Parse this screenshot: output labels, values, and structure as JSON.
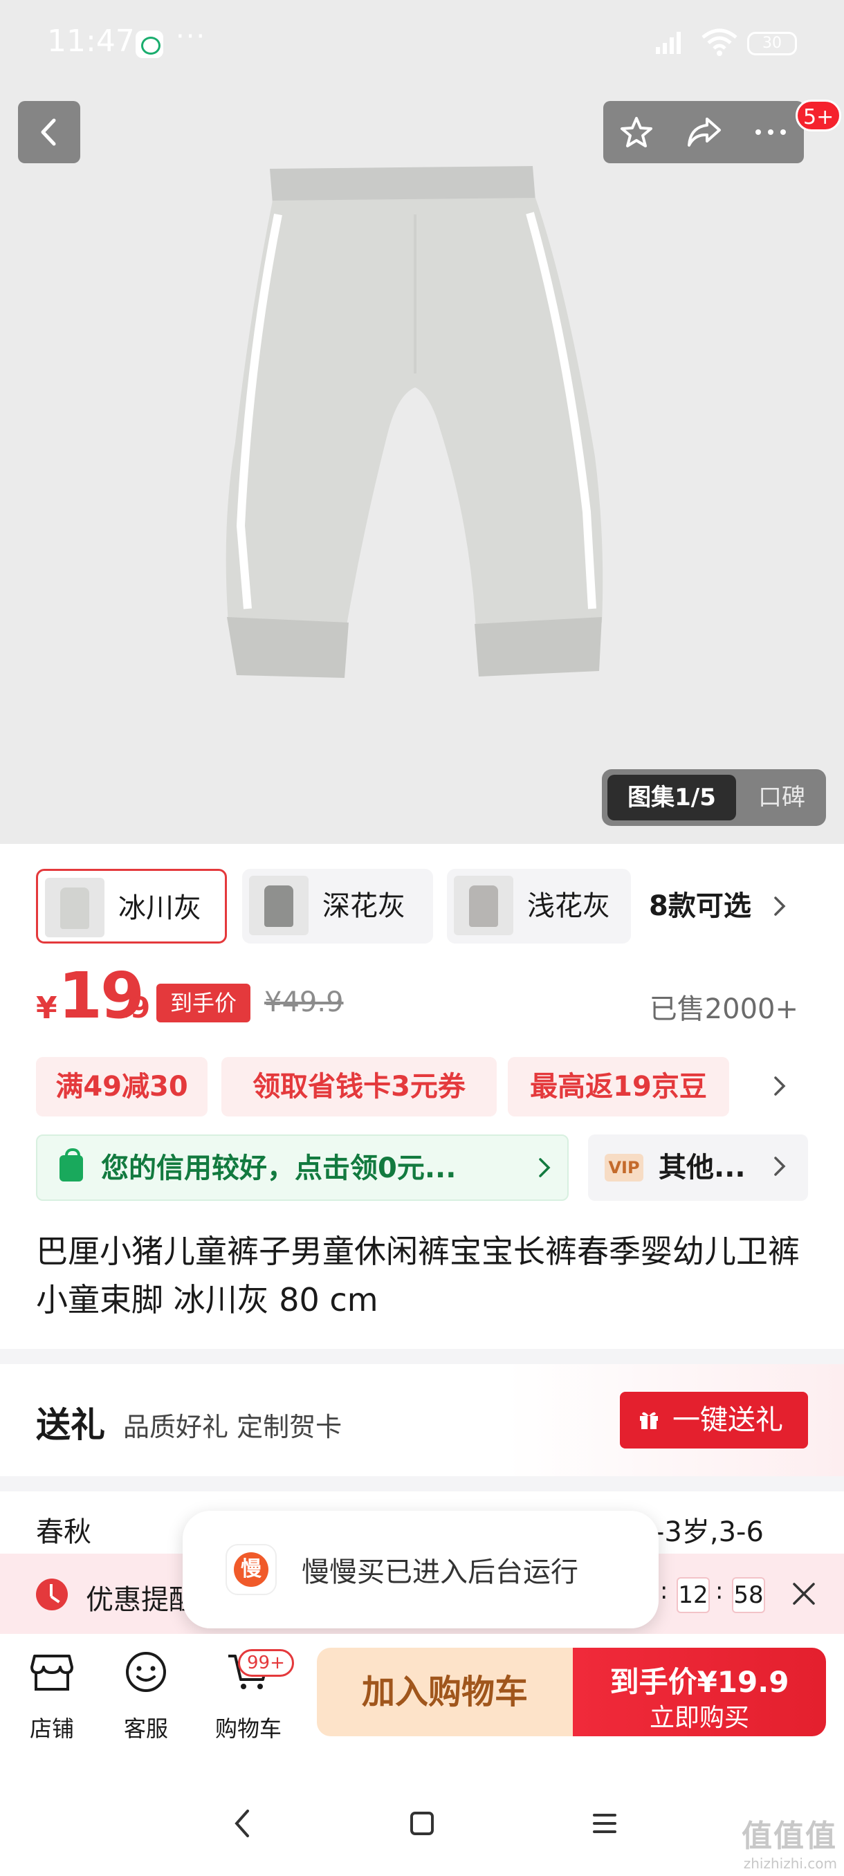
{
  "status_bar": {
    "time": "11:47",
    "dots": "···",
    "network": "HD",
    "battery": "30"
  },
  "hero": {
    "more_badge": "5+",
    "gallery_label": "图集1/5",
    "review_label": "口碑"
  },
  "variants": {
    "items": [
      {
        "label": "冰川灰",
        "selected": true
      },
      {
        "label": "深花灰",
        "selected": false
      },
      {
        "label": "浅花灰",
        "selected": false
      }
    ],
    "more_label": "8款可选"
  },
  "price": {
    "currency": "¥",
    "integer": "19",
    "decimal": ".9",
    "tag": "到手价",
    "original": "¥49.9",
    "sold": "已售2000+"
  },
  "promos": [
    "满49减30",
    "领取省钱卡3元券",
    "最高返19京豆"
  ],
  "credit": {
    "text": "您的信用较好，点击领0元...",
    "vip_badge": "VIP",
    "vip_text": "其他..."
  },
  "product": {
    "title": "巴厘小猪儿童裤子男童休闲裤宝宝长裤春季婴幼儿卫裤小童束脚 冰川灰 80 cm"
  },
  "gift": {
    "label": "送礼",
    "sub": "品质好礼 定制贺卡",
    "button": "一键送礼"
  },
  "spec": {
    "left": "春秋",
    "right": "-3岁,3-6"
  },
  "reminder": {
    "text": "优惠提醒",
    "timer_min": "12",
    "timer_sec": "58",
    "sep": ":"
  },
  "toast": {
    "icon_char": "慢",
    "text": "慢慢买已进入后台运行"
  },
  "bottom_bar": {
    "store": "店铺",
    "service": "客服",
    "cart": "购物车",
    "cart_badge": "99+",
    "add_to_cart": "加入购物车",
    "buy_line1": "到手价¥19.9",
    "buy_line2": "立即购买"
  },
  "watermark": {
    "big": "值值值",
    "small": "zhizhizhi.com"
  },
  "colors": {
    "accent_red": "#e4393c",
    "credit_green": "#127a3f",
    "cart_orange": "#fde3c9"
  }
}
